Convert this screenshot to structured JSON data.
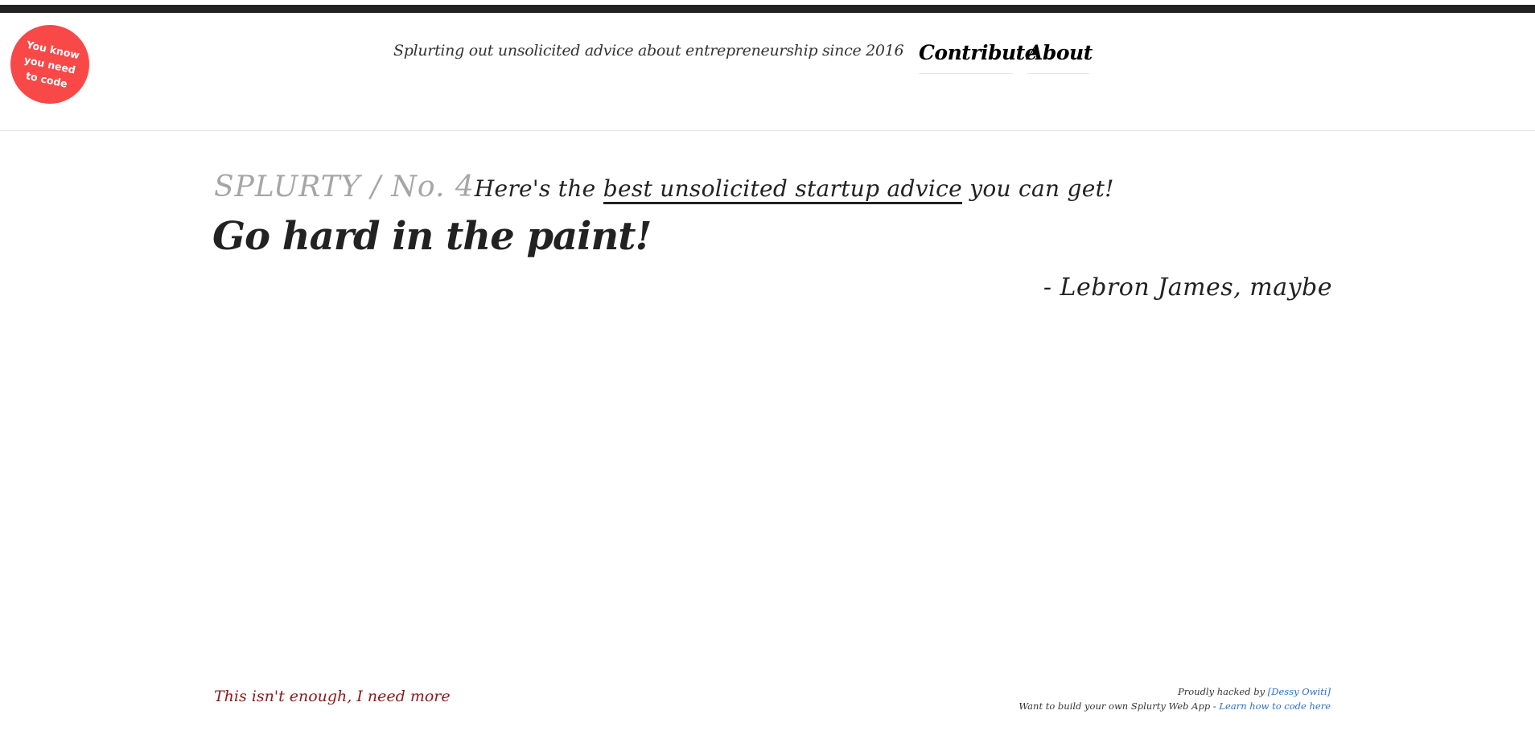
{
  "header": {
    "badge_line1": "You know",
    "badge_line2": "you need",
    "badge_line3": "to code",
    "tagline": "Splurting out unsolicited advice about entrepreneurship since 2016",
    "nav": {
      "contribute": "Contribute",
      "about": "About"
    }
  },
  "main": {
    "brand_number": "SPLURTY / No. 4",
    "intro_before": "Here's the",
    "intro_link": "best unsolicited startup advice",
    "intro_after": "you can get!",
    "advice": "Go hard in the paint!",
    "attribution": "- Lebron James, maybe"
  },
  "footer": {
    "more_link": "This isn't enough, I need more",
    "credit_prefix": "Proudly hacked by",
    "credit_author": "[Dessy Owiti]",
    "build_prefix": "Want to build your own Splurty Web App -",
    "build_link": "Learn how to code here"
  },
  "colors": {
    "badge": "#f94848",
    "top_bar": "#222222",
    "more_link": "#8b1a1a",
    "credit_link": "#2a6fc9",
    "brand_number": "#a6a6a6"
  }
}
